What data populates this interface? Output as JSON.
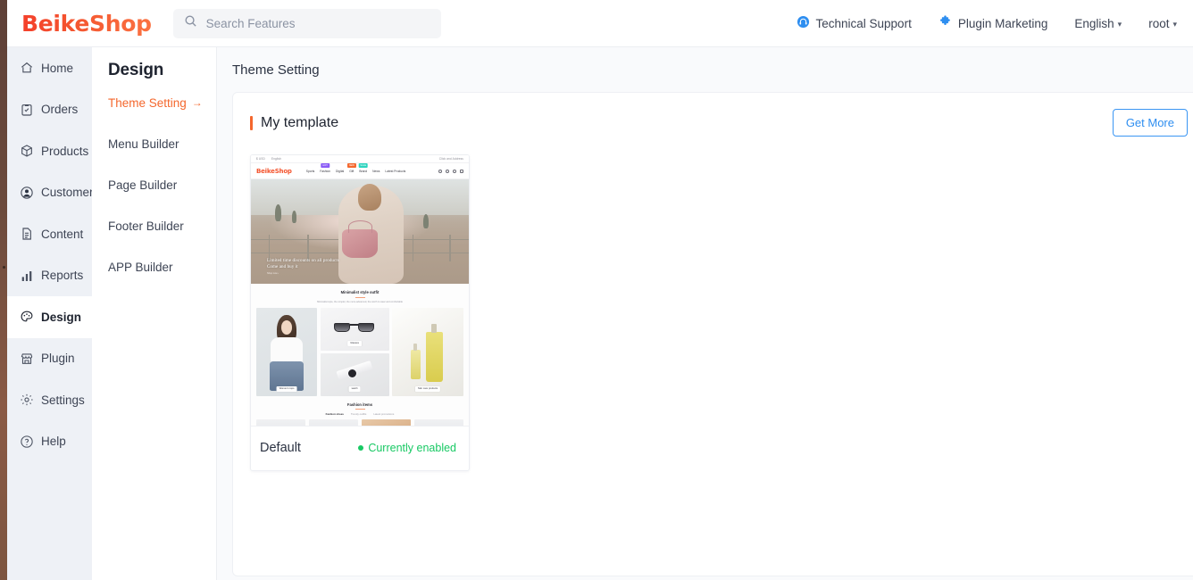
{
  "topbar": {
    "logo": "BeikeShop",
    "search": {
      "placeholder": "Search Features",
      "value": "",
      "icon": "search-icon"
    },
    "links": [
      {
        "label": "Technical Support",
        "icon": "headset-icon"
      },
      {
        "label": "Plugin Marketing",
        "icon": "puzzle-icon"
      },
      {
        "label": "English",
        "icon": "chevron-down-icon",
        "caret": "▾"
      },
      {
        "label": "root",
        "icon": "chevron-down-icon",
        "caret": "▾"
      }
    ]
  },
  "sidebar": {
    "items": [
      {
        "label": "Home",
        "icon": "home-icon",
        "active": false
      },
      {
        "label": "Orders",
        "icon": "clipboard-icon",
        "active": false
      },
      {
        "label": "Products",
        "icon": "box-icon",
        "active": false
      },
      {
        "label": "Customers",
        "icon": "user-circle-icon",
        "active": false
      },
      {
        "label": "Content",
        "icon": "document-icon",
        "active": false
      },
      {
        "label": "Reports",
        "icon": "bar-chart-icon",
        "active": false
      },
      {
        "label": "Design",
        "icon": "palette-icon",
        "active": true
      },
      {
        "label": "Plugin",
        "icon": "store-icon",
        "active": false
      },
      {
        "label": "Settings",
        "icon": "gear-icon",
        "active": false
      },
      {
        "label": "Help",
        "icon": "question-circle-icon",
        "active": false
      }
    ]
  },
  "subnav": {
    "heading": "Design",
    "items": [
      {
        "label": "Theme Setting",
        "arrow": "→",
        "active": true
      },
      {
        "label": "Menu Builder",
        "arrow": "",
        "active": false
      },
      {
        "label": "Page Builder",
        "arrow": "",
        "active": false
      },
      {
        "label": "Footer Builder",
        "arrow": "",
        "active": false
      },
      {
        "label": "APP Builder",
        "arrow": "",
        "active": false
      }
    ]
  },
  "main": {
    "page_title": "Theme Setting",
    "card_title": "My template",
    "get_more_label": "Get More",
    "template": {
      "name": "Default",
      "status_label": "Currently enabled",
      "status_color": "#18c964"
    }
  },
  "thumbnail": {
    "topbar_left": "$ USD",
    "topbar_left2": "English",
    "topbar_right": "Click and Address",
    "logo": "BeikeShop",
    "nav": [
      {
        "label": "Sports",
        "badge": "",
        "badge_color": ""
      },
      {
        "label": "Fashion",
        "badge": "HOT",
        "badge_color": "#8b5cf6"
      },
      {
        "label": "Digital",
        "badge": "",
        "badge_color": ""
      },
      {
        "label": "Gift",
        "badge": "NEW",
        "badge_color": "#f4672d"
      },
      {
        "label": "Brand",
        "badge": "SALE",
        "badge_color": "#2dd4bf"
      },
      {
        "label": "News",
        "badge": "",
        "badge_color": ""
      },
      {
        "label": "Latest Products",
        "badge": "",
        "badge_color": ""
      }
    ],
    "hero_line1": "Limited time discounts on all products",
    "hero_line2": "Come and buy it",
    "hero_line3": "Shop now ›",
    "section_title": "Minimalist style outfit",
    "section_sub": "Minimalist style, the simpler, the more advanced, the worth to wear and comfortable",
    "tiles": [
      {
        "caption": "Women's tops"
      },
      {
        "caption": "Glasses"
      },
      {
        "caption": "watch"
      },
      {
        "caption": "Skin care products"
      }
    ],
    "section2_title": "Fashion items",
    "tabs": [
      {
        "label": "Fashion shoes",
        "active": true
      },
      {
        "label": "Trendy outfits",
        "active": false
      },
      {
        "label": "Latest promotions",
        "active": false
      }
    ]
  },
  "colors": {
    "brand_orange": "#f4672d",
    "logo_red": "#f4402b",
    "accent_blue": "#2e8ef0",
    "status_green": "#18c964",
    "sidebar_bg": "#eef1f6",
    "main_bg": "#f9fafc"
  }
}
